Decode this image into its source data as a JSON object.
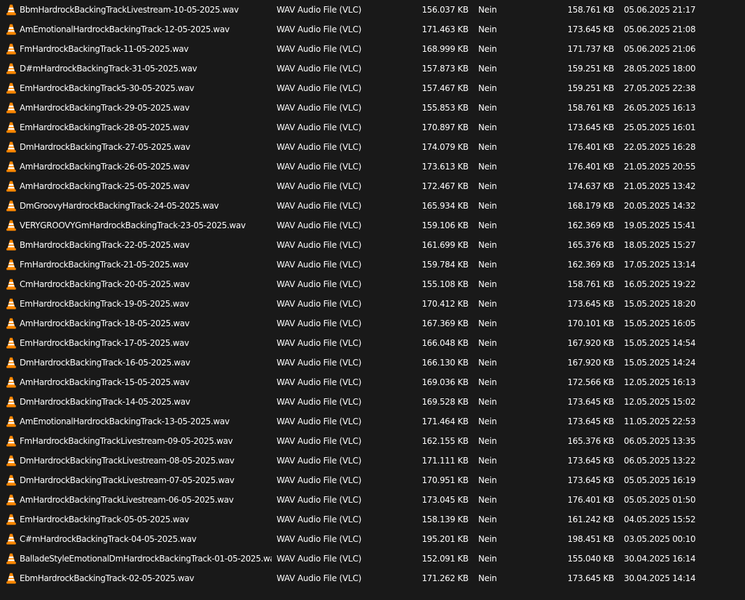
{
  "icon": "vlc-cone-icon",
  "colors": {
    "background": "#191919",
    "text": "#ffffff",
    "vlc_orange": "#ff8800",
    "vlc_white": "#ffffff"
  },
  "files": [
    {
      "name": "BbmHardrockBackingTrackLivestream-10-05-2025.wav",
      "type": "WAV Audio File (VLC)",
      "size": "156.037 KB",
      "compressed": "Nein",
      "original_size": "158.761 KB",
      "modified": "05.06.2025 21:17"
    },
    {
      "name": "AmEmotionalHardrockBackingTrack-12-05-2025.wav",
      "type": "WAV Audio File (VLC)",
      "size": "171.463 KB",
      "compressed": "Nein",
      "original_size": "173.645 KB",
      "modified": "05.06.2025 21:08"
    },
    {
      "name": "FmHardrockBackingTrack-11-05-2025.wav",
      "type": "WAV Audio File (VLC)",
      "size": "168.999 KB",
      "compressed": "Nein",
      "original_size": "171.737 KB",
      "modified": "05.06.2025 21:06"
    },
    {
      "name": "D#mHardrockBackingTrack-31-05-2025.wav",
      "type": "WAV Audio File (VLC)",
      "size": "157.873 KB",
      "compressed": "Nein",
      "original_size": "159.251 KB",
      "modified": "28.05.2025 18:00"
    },
    {
      "name": "EmHardrockBackingTrack5-30-05-2025.wav",
      "type": "WAV Audio File (VLC)",
      "size": "157.467 KB",
      "compressed": "Nein",
      "original_size": "159.251 KB",
      "modified": "27.05.2025 22:38"
    },
    {
      "name": "AmHardrockBackingTrack-29-05-2025.wav",
      "type": "WAV Audio File (VLC)",
      "size": "155.853 KB",
      "compressed": "Nein",
      "original_size": "158.761 KB",
      "modified": "26.05.2025 16:13"
    },
    {
      "name": "EmHardrockBackingTrack-28-05-2025.wav",
      "type": "WAV Audio File (VLC)",
      "size": "170.897 KB",
      "compressed": "Nein",
      "original_size": "173.645 KB",
      "modified": "25.05.2025 16:01"
    },
    {
      "name": "DmHardrockBackingTrack-27-05-2025.wav",
      "type": "WAV Audio File (VLC)",
      "size": "174.079 KB",
      "compressed": "Nein",
      "original_size": "176.401 KB",
      "modified": "22.05.2025 16:28"
    },
    {
      "name": "AmHardrockBackingTrack-26-05-2025.wav",
      "type": "WAV Audio File (VLC)",
      "size": "173.613 KB",
      "compressed": "Nein",
      "original_size": "176.401 KB",
      "modified": "21.05.2025 20:55"
    },
    {
      "name": "AmHardrockBackingTrack-25-05-2025.wav",
      "type": "WAV Audio File (VLC)",
      "size": "172.467 KB",
      "compressed": "Nein",
      "original_size": "174.637 KB",
      "modified": "21.05.2025 13:42"
    },
    {
      "name": "DmGroovyHardrockBackingTrack-24-05-2025.wav",
      "type": "WAV Audio File (VLC)",
      "size": "165.934 KB",
      "compressed": "Nein",
      "original_size": "168.179 KB",
      "modified": "20.05.2025 14:32"
    },
    {
      "name": "VERYGROOVYGmHardrockBackingTrack-23-05-2025.wav",
      "type": "WAV Audio File (VLC)",
      "size": "159.106 KB",
      "compressed": "Nein",
      "original_size": "162.369 KB",
      "modified": "19.05.2025 15:41"
    },
    {
      "name": "BmHardrockBackingTrack-22-05-2025.wav",
      "type": "WAV Audio File (VLC)",
      "size": "161.699 KB",
      "compressed": "Nein",
      "original_size": "165.376 KB",
      "modified": "18.05.2025 15:27"
    },
    {
      "name": "FmHardrockBackingTrack-21-05-2025.wav",
      "type": "WAV Audio File (VLC)",
      "size": "159.784 KB",
      "compressed": "Nein",
      "original_size": "162.369 KB",
      "modified": "17.05.2025 13:14"
    },
    {
      "name": "CmHardrockBackingTrack-20-05-2025.wav",
      "type": "WAV Audio File (VLC)",
      "size": "155.108 KB",
      "compressed": "Nein",
      "original_size": "158.761 KB",
      "modified": "16.05.2025 19:22"
    },
    {
      "name": "EmHardrockBackingTrack-19-05-2025.wav",
      "type": "WAV Audio File (VLC)",
      "size": "170.412 KB",
      "compressed": "Nein",
      "original_size": "173.645 KB",
      "modified": "15.05.2025 18:20"
    },
    {
      "name": "AmHardrockBackingTrack-18-05-2025.wav",
      "type": "WAV Audio File (VLC)",
      "size": "167.369 KB",
      "compressed": "Nein",
      "original_size": "170.101 KB",
      "modified": "15.05.2025 16:05"
    },
    {
      "name": "EmHardrockBackingTrack-17-05-2025.wav",
      "type": "WAV Audio File (VLC)",
      "size": "166.048 KB",
      "compressed": "Nein",
      "original_size": "167.920 KB",
      "modified": "15.05.2025 14:54"
    },
    {
      "name": "DmHardrockBackingTrack-16-05-2025.wav",
      "type": "WAV Audio File (VLC)",
      "size": "166.130 KB",
      "compressed": "Nein",
      "original_size": "167.920 KB",
      "modified": "15.05.2025 14:24"
    },
    {
      "name": "AmHardrockBackingTrack-15-05-2025.wav",
      "type": "WAV Audio File (VLC)",
      "size": "169.036 KB",
      "compressed": "Nein",
      "original_size": "172.566 KB",
      "modified": "12.05.2025 16:13"
    },
    {
      "name": "DmHardrockBackingTrack-14-05-2025.wav",
      "type": "WAV Audio File (VLC)",
      "size": "169.528 KB",
      "compressed": "Nein",
      "original_size": "173.645 KB",
      "modified": "12.05.2025 15:02"
    },
    {
      "name": "AmEmotionalHardrockBackingTrack-13-05-2025.wav",
      "type": "WAV Audio File (VLC)",
      "size": "171.464 KB",
      "compressed": "Nein",
      "original_size": "173.645 KB",
      "modified": "11.05.2025 22:53"
    },
    {
      "name": "FmHardrockBackingTrackLivestream-09-05-2025.wav",
      "type": "WAV Audio File (VLC)",
      "size": "162.155 KB",
      "compressed": "Nein",
      "original_size": "165.376 KB",
      "modified": "06.05.2025 13:35"
    },
    {
      "name": "DmHardrockBackingTrackLivestream-08-05-2025.wav",
      "type": "WAV Audio File (VLC)",
      "size": "171.111 KB",
      "compressed": "Nein",
      "original_size": "173.645 KB",
      "modified": "06.05.2025 13:22"
    },
    {
      "name": "DmHardrockBackingTrackLivestream-07-05-2025.wav",
      "type": "WAV Audio File (VLC)",
      "size": "170.951 KB",
      "compressed": "Nein",
      "original_size": "173.645 KB",
      "modified": "05.05.2025 16:19"
    },
    {
      "name": "AmHardrockBackingTrackLivestream-06-05-2025.wav",
      "type": "WAV Audio File (VLC)",
      "size": "173.045 KB",
      "compressed": "Nein",
      "original_size": "176.401 KB",
      "modified": "05.05.2025 01:50"
    },
    {
      "name": "EmHardrockBackingTrack-05-05-2025.wav",
      "type": "WAV Audio File (VLC)",
      "size": "158.139 KB",
      "compressed": "Nein",
      "original_size": "161.242 KB",
      "modified": "04.05.2025 15:52"
    },
    {
      "name": "C#mHardrockBackingTrack-04-05-2025.wav",
      "type": "WAV Audio File (VLC)",
      "size": "195.201 KB",
      "compressed": "Nein",
      "original_size": "198.451 KB",
      "modified": "03.05.2025 00:10"
    },
    {
      "name": "BalladeStyleEmotionalDmHardrockBackingTrack-01-05-2025.wav",
      "type": "WAV Audio File (VLC)",
      "size": "152.091 KB",
      "compressed": "Nein",
      "original_size": "155.040 KB",
      "modified": "30.04.2025 16:14"
    },
    {
      "name": "EbmHardrockBackingTrack-02-05-2025.wav",
      "type": "WAV Audio File (VLC)",
      "size": "171.262 KB",
      "compressed": "Nein",
      "original_size": "173.645 KB",
      "modified": "30.04.2025 14:14"
    }
  ]
}
